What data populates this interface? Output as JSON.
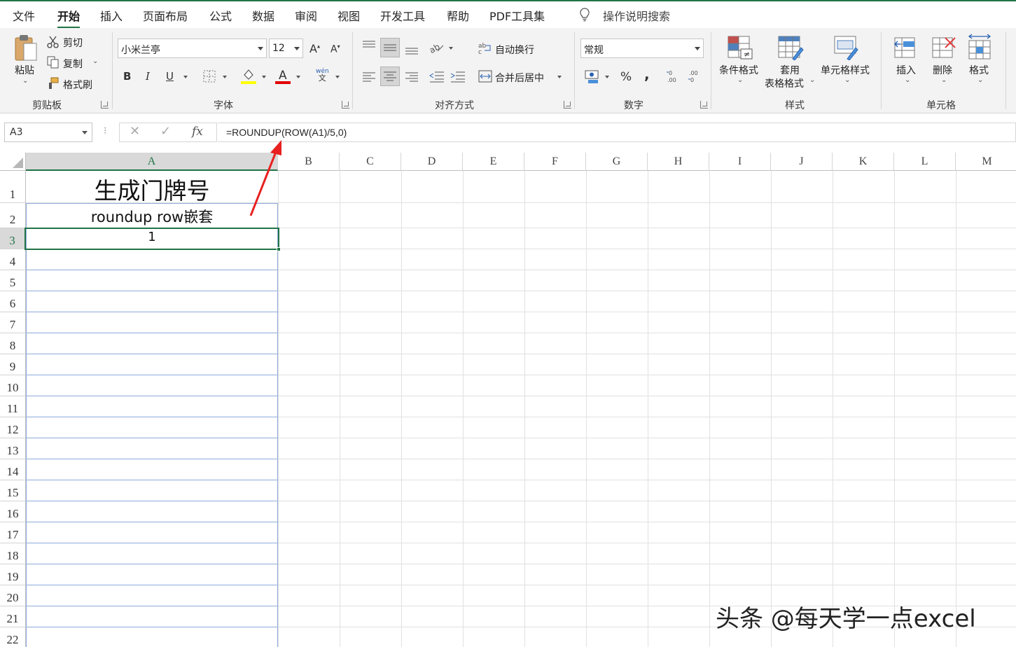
{
  "menu": {
    "tabs": [
      "文件",
      "开始",
      "插入",
      "页面布局",
      "公式",
      "数据",
      "审阅",
      "视图",
      "开发工具",
      "帮助",
      "PDF工具集"
    ],
    "search": "操作说明搜索"
  },
  "ribbon": {
    "clipboard": {
      "paste": "粘贴",
      "cut": "剪切",
      "copy": "复制",
      "format_painter": "格式刷",
      "label": "剪贴板"
    },
    "font": {
      "name": "小米兰亭",
      "size": "12",
      "label": "字体",
      "bold": "B",
      "italic": "I",
      "underline": "U",
      "wen": "wén",
      "wen_char": "文"
    },
    "alignment": {
      "wrap_text": "自动换行",
      "merge_center": "合并后居中",
      "label": "对齐方式"
    },
    "number": {
      "format": "常规",
      "percent": "%",
      "comma": ",",
      "label": "数字"
    },
    "styles": {
      "conditional": "条件格式",
      "table_format_1": "套用",
      "table_format_2": "表格格式",
      "cell_styles": "单元格样式",
      "label": "样式"
    },
    "cells": {
      "insert": "插入",
      "delete": "删除",
      "format": "格式",
      "label": "单元格"
    }
  },
  "formula_bar": {
    "name_box": "A3",
    "formula": "=ROUNDUP(ROW(A1)/5,0)",
    "fx": "fx"
  },
  "sheet": {
    "columns": [
      "A",
      "B",
      "C",
      "D",
      "E",
      "F",
      "G",
      "H",
      "I",
      "J",
      "K",
      "L",
      "M"
    ],
    "rows": [
      "1",
      "2",
      "3",
      "4",
      "5",
      "6",
      "7",
      "8",
      "9",
      "10",
      "11",
      "12",
      "13",
      "14",
      "15",
      "16",
      "17",
      "18",
      "19",
      "20",
      "21",
      "22"
    ],
    "cells": {
      "A1": "生成门牌号",
      "A2": "roundup  row嵌套",
      "A3": "1"
    }
  },
  "watermark": "头条 @每天学一点excel"
}
